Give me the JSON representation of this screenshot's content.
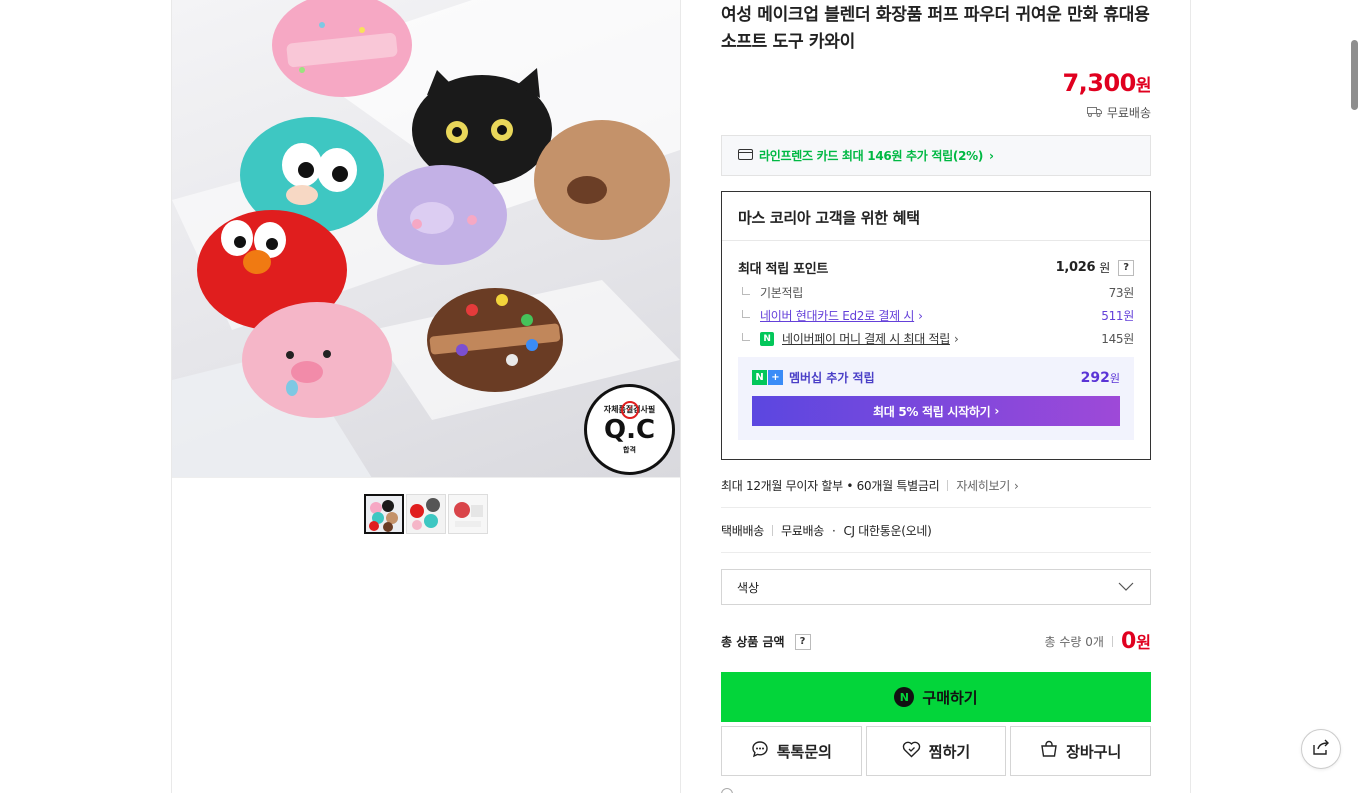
{
  "product": {
    "title": "여성 메이크업 블렌더 화장품 퍼프 파우더 귀여운 만화 휴대용 소프트 도구 카와이",
    "price": "7,300",
    "price_unit": "원",
    "shipping": "무료배송",
    "qc_badge_text": "자체품질검사필",
    "qc_badge_main": "Q.C",
    "qc_badge_pass": "합격"
  },
  "card_benefit": {
    "label": "라인프렌즈 카드 최대 146원 추가 적립(2%)"
  },
  "benefit": {
    "heading": "마스 코리아 고객을 위한 혜택",
    "max_points_label": "최대 적립 포인트",
    "max_points_value": "1,026",
    "max_points_unit": "원",
    "help_mark": "?",
    "basic_label": "기본적립",
    "basic_value": "73원",
    "hyundai_label": "네이버 현대카드 Ed2로 결제 시",
    "hyundai_value": "511원",
    "npay_label": "네이버페이 머니 결제 시 최대 적립",
    "npay_value": "145원",
    "membership_label": "멤버십 추가 적립",
    "membership_value": "292",
    "membership_unit": "원",
    "membership_button": "최대 5% 적립 시작하기"
  },
  "installment": {
    "text": "최대 12개월 무이자 할부 • 60개월 특별금리",
    "more": "자세히보기"
  },
  "delivery": {
    "type": "택배배송",
    "fee": "무료배송",
    "carrier": "CJ 대한통운(오네)"
  },
  "option": {
    "placeholder": "색상"
  },
  "total": {
    "label": "총 상품 금액",
    "quantity": "총 수량 0개",
    "amount": "0",
    "unit": "원"
  },
  "buttons": {
    "buy": "구매하기",
    "talk": "톡톡문의",
    "wish": "찜하기",
    "cart": "장바구니"
  },
  "colors": {
    "price_red": "#e0001f",
    "naver_green": "#03d53a",
    "membership_purple": "#5b47e0"
  }
}
